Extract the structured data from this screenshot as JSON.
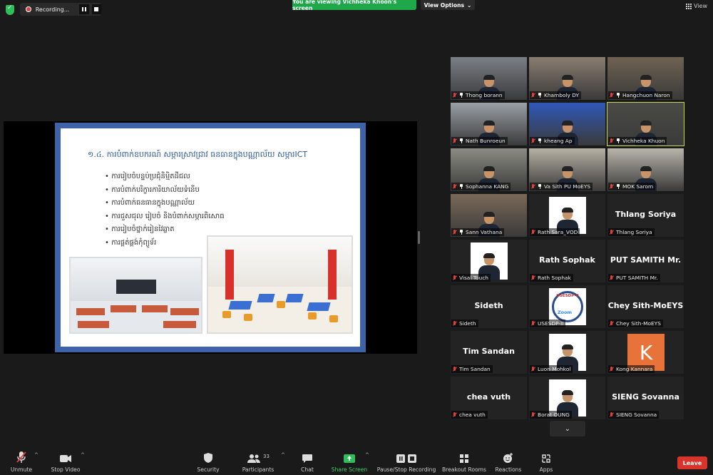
{
  "top": {
    "recording_label": "Recording...",
    "viewing_banner": "You are viewing Vichheka Khoon's screen",
    "view_options": "View Options",
    "view_label": "View"
  },
  "slide": {
    "title": "១.៤. ការបំពាក់ឧបករណ៍ សម្ភារស្រាវជ្រាវ ធនធានក្នុងបណ្ណាល័យ សម្ភារICT",
    "bullets": [
      "ការរៀបចំបន្ទប់ប្រជុំនិម្មិតដីជល",
      "ការបំពាក់បរិក្ខារការិយាល័យទំនើប",
      "ការបំពាក់ធនធានក្នុងបណ្ណាល័យ",
      "ការជួសជុល រៀបចំ និងបំពាក់សម្ភារពិសោធ",
      "ការរៀបចំថ្នាក់រៀនវៃឆ្លាត",
      "ការផ្គត់ផ្គង់កុំព្យូទ័រ"
    ]
  },
  "participants": [
    {
      "name": "Thong borann",
      "type": "video"
    },
    {
      "name": "Khamboly DY",
      "type": "video"
    },
    {
      "name": "Hangchuon Naron",
      "type": "video"
    },
    {
      "name": "Nath Bunroeun",
      "type": "video"
    },
    {
      "name": "kheang Ap",
      "type": "video"
    },
    {
      "name": "Vichheka Khuon",
      "type": "video"
    },
    {
      "name": "Sophanna KANG",
      "type": "video"
    },
    {
      "name": "Va Sith PU MoEYS",
      "type": "video"
    },
    {
      "name": "MOK Sarom",
      "type": "video"
    },
    {
      "name": "Sann Vathana",
      "type": "video"
    },
    {
      "name": "Rath Sara_VOD",
      "type": "photo"
    },
    {
      "name": "Thlang Soriya",
      "type": "name",
      "big": "Thlang Soriya"
    },
    {
      "name": "Visal Touch",
      "type": "photo"
    },
    {
      "name": "Rath Sophak",
      "type": "name",
      "big": "Rath Sophak"
    },
    {
      "name": "PUT SAMITH Mr.",
      "type": "name",
      "big": "PUT SAMITH Mr."
    },
    {
      "name": "Sideth",
      "type": "name",
      "big": "Sideth"
    },
    {
      "name": "USESDP-II",
      "type": "logo",
      "logo_text": "USESDP-II",
      "logo_zoom": "Zoom"
    },
    {
      "name": "Chey Sith-MoEYS",
      "type": "name",
      "big": "Chey Sith-MoEYS"
    },
    {
      "name": "Tim Sandan",
      "type": "name",
      "big": "Tim Sandan"
    },
    {
      "name": "Luon Mohkol",
      "type": "photo"
    },
    {
      "name": "Kong Kannara",
      "type": "letter",
      "letter": "K"
    },
    {
      "name": "chea vuth",
      "type": "name",
      "big": "chea vuth"
    },
    {
      "name": "Borat OUNG",
      "type": "photo"
    },
    {
      "name": "SIENG Sovanna",
      "type": "name",
      "big": "SIENG Sovanna"
    }
  ],
  "toolbar": {
    "unmute": "Unmute",
    "stop_video": "Stop Video",
    "security": "Security",
    "participants": "Participants",
    "participants_count": "33",
    "chat": "Chat",
    "share_screen": "Share Screen",
    "pause_recording": "Pause/Stop Recording",
    "breakout": "Breakout Rooms",
    "reactions": "Reactions",
    "apps": "Apps",
    "end": "Leave"
  },
  "colors": {
    "share_green": "#1fa84a",
    "end_red": "#d9342b",
    "active_speaker": "#c8d84a"
  }
}
